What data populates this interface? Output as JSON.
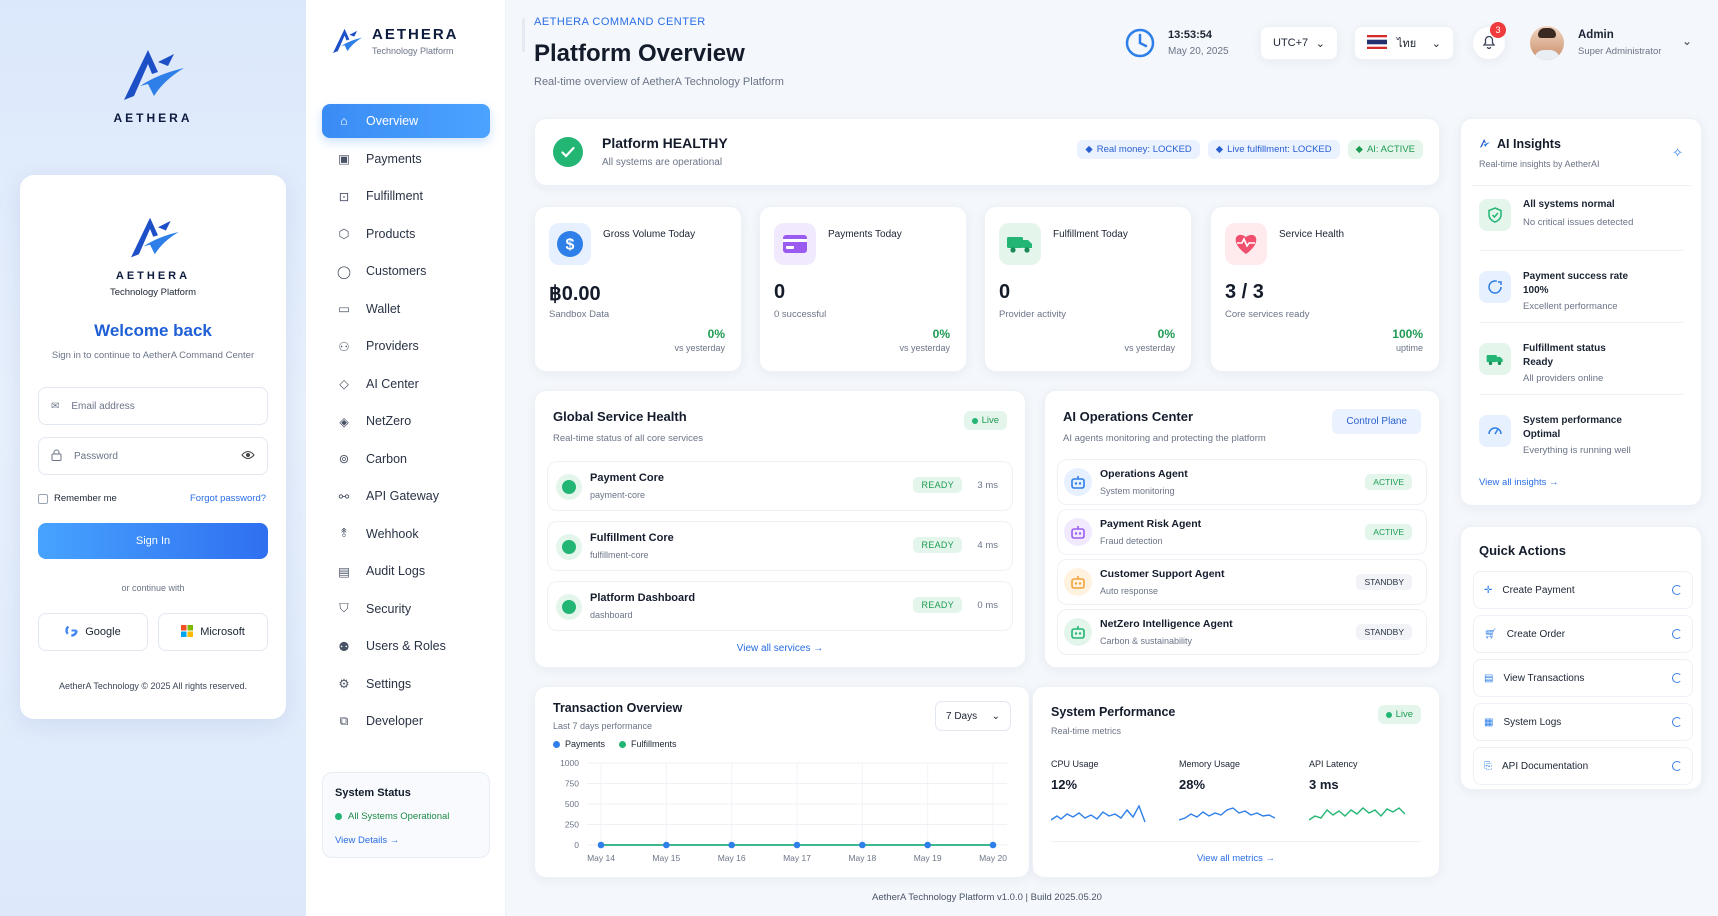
{
  "login": {
    "brand_top": "AETHERA",
    "brand_card": "AETHERA",
    "brand_sub": "Technology Platform",
    "welcome": "Welcome back",
    "subtitle": "Sign in to continue to AetherA Command Center",
    "email_placeholder": "Email address",
    "password_placeholder": "Password",
    "remember": "Remember me",
    "forgot": "Forgot password?",
    "signin": "Sign In",
    "or_continue": "or continue with",
    "google": "Google",
    "microsoft": "Microsoft",
    "copyright": "AetherA Technology © 2025 All rights reserved."
  },
  "sidebar": {
    "brand": "AETHERA",
    "brand_sub": "Technology Platform",
    "items": [
      {
        "label": "Overview",
        "icon": "home-icon"
      },
      {
        "label": "Payments",
        "icon": "payments-icon"
      },
      {
        "label": "Fulfillment",
        "icon": "package-icon"
      },
      {
        "label": "Products",
        "icon": "cube-icon"
      },
      {
        "label": "Customers",
        "icon": "user-icon"
      },
      {
        "label": "Wallet",
        "icon": "wallet-icon"
      },
      {
        "label": "Providers",
        "icon": "providers-icon"
      },
      {
        "label": "AI Center",
        "icon": "diamond-icon"
      },
      {
        "label": "NetZero",
        "icon": "netzero-icon"
      },
      {
        "label": "Carbon",
        "icon": "carbon-icon"
      },
      {
        "label": "API Gateway",
        "icon": "api-icon"
      },
      {
        "label": "Wehhook",
        "icon": "webhook-icon"
      },
      {
        "label": "Audit Logs",
        "icon": "audit-icon"
      },
      {
        "label": "Security",
        "icon": "shield-icon"
      },
      {
        "label": "Users & Roles",
        "icon": "users-icon"
      },
      {
        "label": "Settings",
        "icon": "gear-icon"
      },
      {
        "label": "Developer",
        "icon": "developer-icon"
      }
    ],
    "status_title": "System Status",
    "status_text": "All Systems Operational",
    "status_link": "View Details"
  },
  "header": {
    "kicker": "AETHERA COMMAND CENTER",
    "title": "Platform Overview",
    "subtitle": "Real-time overview of AetherA Technology Platform",
    "time": "13:53:54",
    "date": "May 20, 2025",
    "timezone": "UTC+7",
    "language": "ไทย",
    "notifications": "3",
    "user_name": "Admin",
    "user_role": "Super Administrator"
  },
  "health": {
    "title": "Platform HEALTHY",
    "subtitle": "All systems are operational",
    "badges": [
      "Real money: LOCKED",
      "Live fulfillment: LOCKED",
      "AI: ACTIVE"
    ]
  },
  "stats": [
    {
      "label": "Gross Volume Today",
      "value": "฿0.00",
      "sub": "Sandbox Data",
      "change": "0%",
      "change_sub": "vs yesterday"
    },
    {
      "label": "Payments Today",
      "value": "0",
      "sub": "0 successful",
      "change": "0%",
      "change_sub": "vs yesterday"
    },
    {
      "label": "Fulfillment Today",
      "value": "0",
      "sub": "Provider activity",
      "change": "0%",
      "change_sub": "vs yesterday"
    },
    {
      "label": "Service Health",
      "value": "3 / 3",
      "sub": "Core services ready",
      "change": "100%",
      "change_sub": "uptime"
    }
  ],
  "services": {
    "title": "Global Service Health",
    "subtitle": "Real-time status of all core services",
    "live": "Live",
    "rows": [
      {
        "name": "Payment Core",
        "id": "payment-core",
        "status": "READY",
        "latency": "3 ms"
      },
      {
        "name": "Fulfillment Core",
        "id": "fulfillment-core",
        "status": "READY",
        "latency": "4 ms"
      },
      {
        "name": "Platform Dashboard",
        "id": "dashboard",
        "status": "READY",
        "latency": "0 ms"
      }
    ],
    "link": "View all services"
  },
  "ai_ops": {
    "title": "AI Operations Center",
    "subtitle": "AI agents monitoring and protecting the platform",
    "button": "Control Plane",
    "agents": [
      {
        "name": "Operations Agent",
        "desc": "System monitoring",
        "status": "ACTIVE"
      },
      {
        "name": "Payment Risk Agent",
        "desc": "Fraud detection",
        "status": "ACTIVE"
      },
      {
        "name": "Customer Support Agent",
        "desc": "Auto response",
        "status": "STANDBY"
      },
      {
        "name": "NetZero Intelligence Agent",
        "desc": "Carbon & sustainability",
        "status": "STANDBY"
      }
    ]
  },
  "transactions": {
    "title": "Transaction Overview",
    "subtitle": "Last 7 days performance",
    "range": "7 Days",
    "legend": [
      "Payments",
      "Fulfillments"
    ]
  },
  "chart_data": {
    "type": "line",
    "categories": [
      "May 14",
      "May 15",
      "May 16",
      "May 17",
      "May 18",
      "May 19",
      "May 20"
    ],
    "series": [
      {
        "name": "Payments",
        "values": [
          0,
          0,
          0,
          0,
          0,
          0,
          0
        ],
        "color": "#2f7fe8"
      },
      {
        "name": "Fulfillments",
        "values": [
          0,
          0,
          0,
          0,
          0,
          0,
          0
        ],
        "color": "#22b573"
      }
    ],
    "yticks": [
      "1000",
      "750",
      "500",
      "250",
      "0"
    ],
    "ylim": [
      0,
      1000
    ],
    "grid": true
  },
  "performance": {
    "title": "System Performance",
    "subtitle": "Real-time metrics",
    "live": "Live",
    "metrics": [
      {
        "label": "CPU Usage",
        "value": "12%"
      },
      {
        "label": "Memory Usage",
        "value": "28%"
      },
      {
        "label": "API Latency",
        "value": "3 ms"
      }
    ],
    "link": "View all metrics"
  },
  "insights": {
    "title": "AI Insights",
    "subtitle": "Real-time insights by AetherAI",
    "items": [
      {
        "title": "All systems normal",
        "line2": "",
        "line3": "No critical issues detected"
      },
      {
        "title": "Payment success rate",
        "line2": "100%",
        "line3": "Excellent performance"
      },
      {
        "title": "Fulfillment status",
        "line2": "Ready",
        "line3": "All providers online"
      },
      {
        "title": "System performance",
        "line2": "Optimal",
        "line3": "Everything is running well"
      }
    ],
    "link": "View all insights"
  },
  "quick_actions": {
    "title": "Quick Actions",
    "items": [
      "Create Payment",
      "Create Order",
      "View Transactions",
      "System Logs",
      "API Documentation"
    ]
  },
  "footer": "AetherA Technology Platform v1.0.0 | Build 2025.05.20",
  "colors": {
    "accent": "#2f7fe8",
    "success": "#22b573",
    "navy": "#0d1b3e"
  }
}
